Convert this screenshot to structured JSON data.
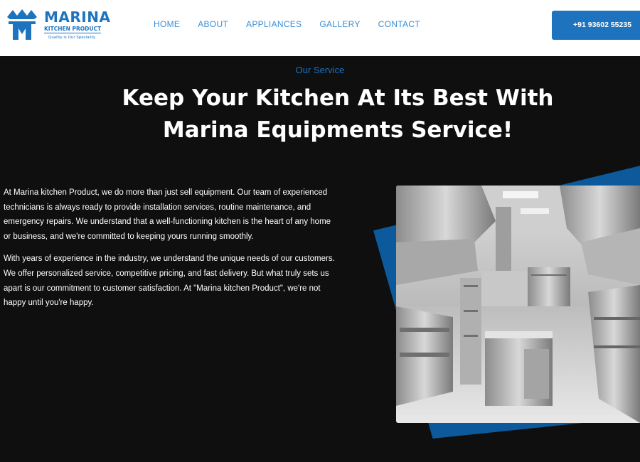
{
  "brand": {
    "name": "MARINA",
    "subtitle": "KITCHEN PRODUCT",
    "tagline": "Quality is Our Speciality",
    "color": "#1e73be"
  },
  "nav": {
    "items": [
      "HOME",
      "ABOUT",
      "APPLIANCES",
      "GALLERY",
      "CONTACT"
    ]
  },
  "phone_button": "+91 93602 55235",
  "section": {
    "eyebrow": "Our Service",
    "title_line1": "Keep Your Kitchen At Its Best With",
    "title_line2": "Marina Equipments Service!",
    "paragraph1": "At Marina kitchen Product, we do more than just sell equipment. Our team of experienced technicians is always ready to provide installation services, routine maintenance, and emergency repairs. We understand that a well-functioning kitchen is the heart of any home or business, and we're committed to keeping yours running smoothly.",
    "paragraph2": "With years of experience in the industry, we understand the unique needs of our customers. We offer personalized service, competitive pricing, and fast delivery. But what truly sets us apart is our commitment to customer satisfaction. At \"Marina kitchen Product\", we're not happy until you're happy."
  },
  "colors": {
    "background": "#0f0f0f",
    "accent": "#1e73be",
    "deco_shape": "#0c5a9c"
  },
  "icons": [
    "crown-logo-icon"
  ]
}
